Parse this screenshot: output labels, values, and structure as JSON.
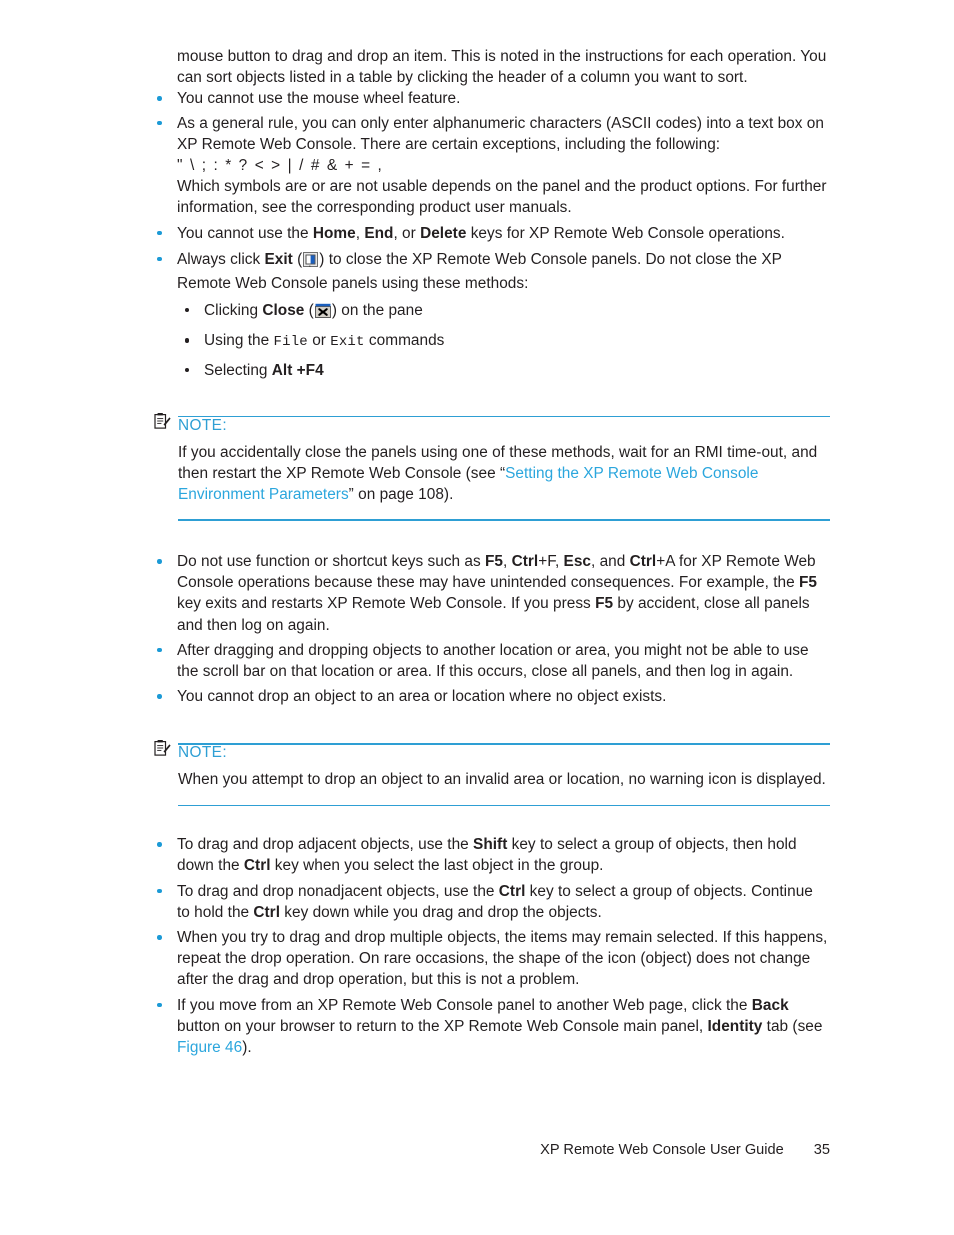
{
  "document": {
    "title": "XP Remote Web Console User Guide",
    "page_number": "35",
    "accent_color": "#2e9fd4",
    "bullet_color": "#1b9ad6",
    "link_color": "#2ba6dd",
    "text_color": "#231f20"
  },
  "body": {
    "intro_paragraph": "mouse button to drag and drop an item. This is noted in the instructions for each operation. You can sort objects listed in a table by clicking the header of a column you want to sort.",
    "bullets_top": {
      "b1": "You cannot use the mouse wheel feature.",
      "b2_line1": "As a general rule, you can only enter alphanumeric characters (ASCII codes) into a text box on XP Remote Web Console. There are certain exceptions, including the following:",
      "b2_symbols": "\" \\ ; : * ? < > | / # & + = ,",
      "b2_line2": "Which symbols are or are not usable depends on the panel and the product options. For further information, see the corresponding product user manuals.",
      "b3_pre": "You cannot use the ",
      "b3_k1": "Home",
      "b3_sep1": ", ",
      "b3_k2": "End",
      "b3_sep2": ", or ",
      "b3_k3": "Delete",
      "b3_post": " keys for XP Remote Web Console operations.",
      "b4_pre": "Always click ",
      "b4_k1": "Exit",
      "b4_mid": " (",
      "b4_icon": "exit-panel-icon",
      "b4_post": ") to close the XP Remote Web Console panels. Do not close the XP Remote Web Console panels using these methods:",
      "sub1_pre": "Clicking ",
      "sub1_k1": "Close",
      "sub1_mid": " (",
      "sub1_icon": "close-window-icon",
      "sub1_post": ") on the pane",
      "sub2_pre": "Using the ",
      "sub2_cmd1": "File",
      "sub2_mid": " or ",
      "sub2_cmd2": "Exit",
      "sub2_post": " commands",
      "sub3_pre": "Selecting ",
      "sub3_k1": "Alt +F4"
    },
    "note1": {
      "icon": "note-clipboard-icon",
      "label": "NOTE:",
      "text_pre": "If you accidentally close the panels using one of these methods, wait for an RMI time-out, and then restart the XP Remote Web Console (see “",
      "link": "Setting the XP Remote Web Console Environment Parameters",
      "text_post": "” on page 108)."
    },
    "bullets_middle": {
      "b1_pre": "Do not use function or shortcut keys such as ",
      "b1_k1": "F5",
      "b1_s1": ", ",
      "b1_k2": "Ctrl",
      "b1_k2b": "+F",
      "b1_s2": ", ",
      "b1_k3": "Esc",
      "b1_s3": ", and ",
      "b1_k4": "Ctrl",
      "b1_k4b": "+A",
      "b1_mid": " for XP Remote Web Console operations because these may have unintended consequences. For example, the ",
      "b1_k5": "F5",
      "b1_mid2": " key exits and restarts XP Remote Web Console. If you press ",
      "b1_k6": "F5",
      "b1_post": " by accident, close all panels and then log on again.",
      "b2": "After dragging and dropping objects to another location or area, you might not be able to use the scroll bar on that location or area. If this occurs, close all panels, and then log in again.",
      "b3": "You cannot drop an object to an area or location where no object exists."
    },
    "note2": {
      "icon": "note-clipboard-icon",
      "label": "NOTE:",
      "text": "When you attempt to drop an object to an invalid area or location, no warning icon is displayed."
    },
    "bullets_bottom": {
      "b1_pre": "To drag and drop adjacent objects, use the ",
      "b1_k1": "Shift",
      "b1_mid": " key to select a group of objects, then hold down the ",
      "b1_k2": "Ctrl",
      "b1_post": " key when you select the last object in the group.",
      "b2_pre": "To drag and drop nonadjacent objects, use the ",
      "b2_k1": "Ctrl",
      "b2_mid": " key to select a group of objects. Continue to hold the ",
      "b2_k2": "Ctrl",
      "b2_post": " key down while you drag and drop the objects.",
      "b3": "When you try to drag and drop multiple objects, the items may remain selected. If this happens, repeat the drop operation. On rare occasions, the shape of the icon (object) does not change after the drag and drop operation, but this is not a problem.",
      "b4_pre": "If you move from an XP Remote Web Console panel to another Web page, click the ",
      "b4_k1": "Back",
      "b4_mid": " button on your browser to return to the XP Remote Web Console main panel, ",
      "b4_k2": "Identity",
      "b4_mid2": " tab (see ",
      "b4_link": "Figure 46",
      "b4_post": ")."
    }
  },
  "footer": {
    "guide_title": "XP Remote Web Console User Guide",
    "page_number": "35"
  }
}
